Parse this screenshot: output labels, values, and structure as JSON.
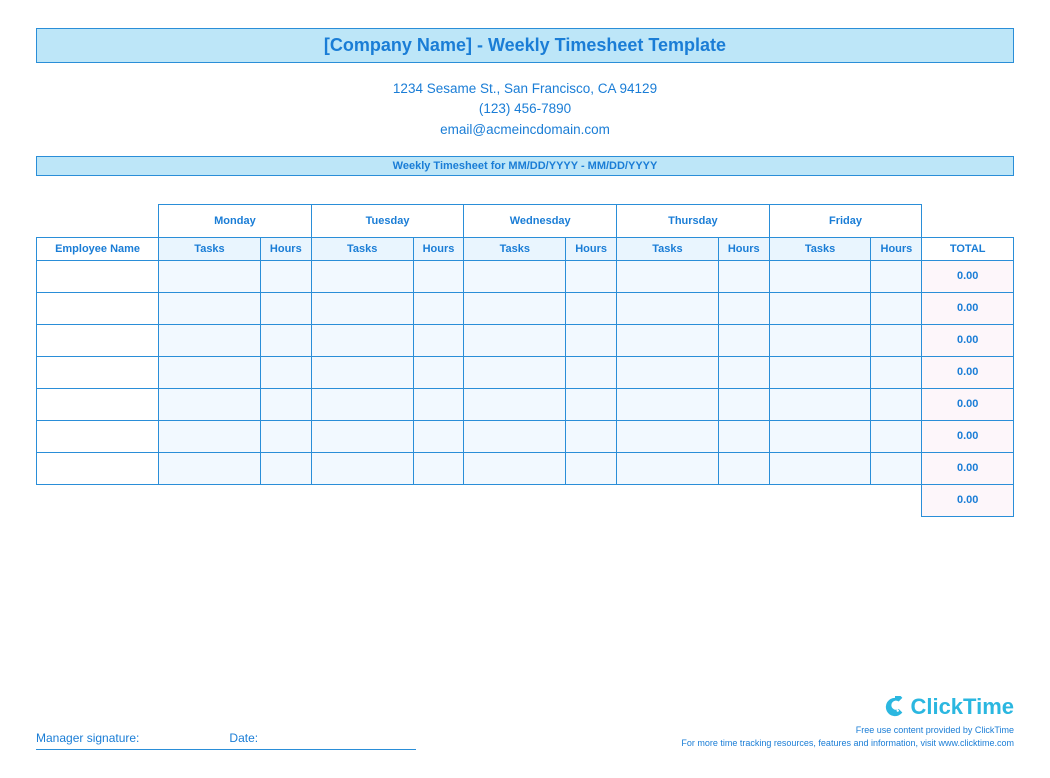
{
  "title": "[Company Name] - Weekly Timesheet Template",
  "contact": {
    "address": "1234 Sesame St.,  San Francisco, CA 94129",
    "phone": "(123) 456-7890",
    "email": "email@acmeincdomain.com"
  },
  "period_label": "Weekly Timesheet for MM/DD/YYYY - MM/DD/YYYY",
  "columns": {
    "employee": "Employee Name",
    "tasks": "Tasks",
    "hours": "Hours",
    "total": "TOTAL"
  },
  "days": [
    "Monday",
    "Tuesday",
    "Wednesday",
    "Thursday",
    "Friday"
  ],
  "rows": [
    {
      "name": "",
      "t1": "",
      "h1": "",
      "t2": "",
      "h2": "",
      "t3": "",
      "h3": "",
      "t4": "",
      "h4": "",
      "t5": "",
      "h5": "",
      "total": "0.00"
    },
    {
      "name": "",
      "t1": "",
      "h1": "",
      "t2": "",
      "h2": "",
      "t3": "",
      "h3": "",
      "t4": "",
      "h4": "",
      "t5": "",
      "h5": "",
      "total": "0.00"
    },
    {
      "name": "",
      "t1": "",
      "h1": "",
      "t2": "",
      "h2": "",
      "t3": "",
      "h3": "",
      "t4": "",
      "h4": "",
      "t5": "",
      "h5": "",
      "total": "0.00"
    },
    {
      "name": "",
      "t1": "",
      "h1": "",
      "t2": "",
      "h2": "",
      "t3": "",
      "h3": "",
      "t4": "",
      "h4": "",
      "t5": "",
      "h5": "",
      "total": "0.00"
    },
    {
      "name": "",
      "t1": "",
      "h1": "",
      "t2": "",
      "h2": "",
      "t3": "",
      "h3": "",
      "t4": "",
      "h4": "",
      "t5": "",
      "h5": "",
      "total": "0.00"
    },
    {
      "name": "",
      "t1": "",
      "h1": "",
      "t2": "",
      "h2": "",
      "t3": "",
      "h3": "",
      "t4": "",
      "h4": "",
      "t5": "",
      "h5": "",
      "total": "0.00"
    },
    {
      "name": "",
      "t1": "",
      "h1": "",
      "t2": "",
      "h2": "",
      "t3": "",
      "h3": "",
      "t4": "",
      "h4": "",
      "t5": "",
      "h5": "",
      "total": "0.00"
    }
  ],
  "grand_total": "0.00",
  "signature": {
    "manager": "Manager signature:",
    "date": "Date:"
  },
  "brand": {
    "name": "ClickTime",
    "line1": "Free use content provided by ClickTime",
    "line2": "For more time tracking resources, features and information, visit www.clicktime.com"
  }
}
